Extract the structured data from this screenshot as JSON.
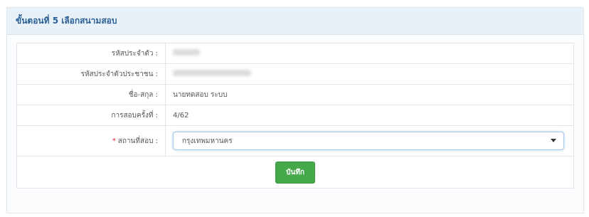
{
  "panel": {
    "title": "ขั้นตอนที่ 5 เลือกสนามสอบ"
  },
  "form": {
    "id_label": "รหัสประจำตัว :",
    "citizen_id_label": "รหัสประจำตัวประชาชน :",
    "name_label": "ชื่อ-สกุล :",
    "name_value": "นายทดสอบ ระบบ",
    "round_label": "การสอบครั้งที่ :",
    "round_value": "4/62",
    "required_mark": "*",
    "venue_label": "สถานที่สอบ :",
    "venue_selected": "กรุงเทพมหานคร",
    "save_label": "บันทึก"
  },
  "colors": {
    "accent": "#2a5f96",
    "save": "#45a84b",
    "required": "#d9232e"
  }
}
